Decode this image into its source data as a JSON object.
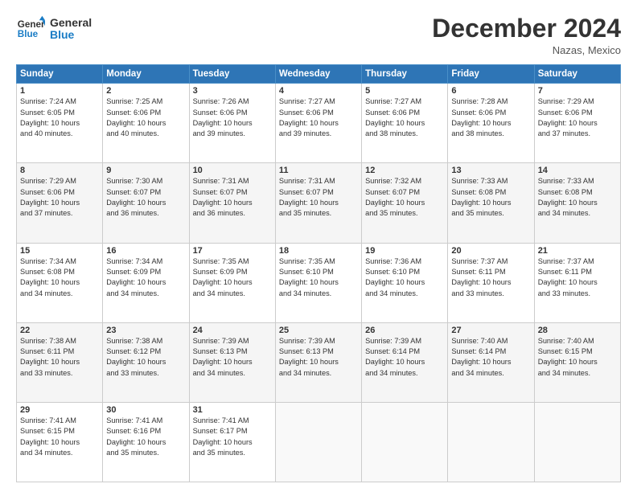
{
  "header": {
    "logo_line1": "General",
    "logo_line2": "Blue",
    "month_title": "December 2024",
    "location": "Nazas, Mexico"
  },
  "days_of_week": [
    "Sunday",
    "Monday",
    "Tuesday",
    "Wednesday",
    "Thursday",
    "Friday",
    "Saturday"
  ],
  "weeks": [
    [
      {
        "day": "1",
        "info": "Sunrise: 7:24 AM\nSunset: 6:05 PM\nDaylight: 10 hours\nand 40 minutes."
      },
      {
        "day": "2",
        "info": "Sunrise: 7:25 AM\nSunset: 6:06 PM\nDaylight: 10 hours\nand 40 minutes."
      },
      {
        "day": "3",
        "info": "Sunrise: 7:26 AM\nSunset: 6:06 PM\nDaylight: 10 hours\nand 39 minutes."
      },
      {
        "day": "4",
        "info": "Sunrise: 7:27 AM\nSunset: 6:06 PM\nDaylight: 10 hours\nand 39 minutes."
      },
      {
        "day": "5",
        "info": "Sunrise: 7:27 AM\nSunset: 6:06 PM\nDaylight: 10 hours\nand 38 minutes."
      },
      {
        "day": "6",
        "info": "Sunrise: 7:28 AM\nSunset: 6:06 PM\nDaylight: 10 hours\nand 38 minutes."
      },
      {
        "day": "7",
        "info": "Sunrise: 7:29 AM\nSunset: 6:06 PM\nDaylight: 10 hours\nand 37 minutes."
      }
    ],
    [
      {
        "day": "8",
        "info": "Sunrise: 7:29 AM\nSunset: 6:06 PM\nDaylight: 10 hours\nand 37 minutes."
      },
      {
        "day": "9",
        "info": "Sunrise: 7:30 AM\nSunset: 6:07 PM\nDaylight: 10 hours\nand 36 minutes."
      },
      {
        "day": "10",
        "info": "Sunrise: 7:31 AM\nSunset: 6:07 PM\nDaylight: 10 hours\nand 36 minutes."
      },
      {
        "day": "11",
        "info": "Sunrise: 7:31 AM\nSunset: 6:07 PM\nDaylight: 10 hours\nand 35 minutes."
      },
      {
        "day": "12",
        "info": "Sunrise: 7:32 AM\nSunset: 6:07 PM\nDaylight: 10 hours\nand 35 minutes."
      },
      {
        "day": "13",
        "info": "Sunrise: 7:33 AM\nSunset: 6:08 PM\nDaylight: 10 hours\nand 35 minutes."
      },
      {
        "day": "14",
        "info": "Sunrise: 7:33 AM\nSunset: 6:08 PM\nDaylight: 10 hours\nand 34 minutes."
      }
    ],
    [
      {
        "day": "15",
        "info": "Sunrise: 7:34 AM\nSunset: 6:08 PM\nDaylight: 10 hours\nand 34 minutes."
      },
      {
        "day": "16",
        "info": "Sunrise: 7:34 AM\nSunset: 6:09 PM\nDaylight: 10 hours\nand 34 minutes."
      },
      {
        "day": "17",
        "info": "Sunrise: 7:35 AM\nSunset: 6:09 PM\nDaylight: 10 hours\nand 34 minutes."
      },
      {
        "day": "18",
        "info": "Sunrise: 7:35 AM\nSunset: 6:10 PM\nDaylight: 10 hours\nand 34 minutes."
      },
      {
        "day": "19",
        "info": "Sunrise: 7:36 AM\nSunset: 6:10 PM\nDaylight: 10 hours\nand 34 minutes."
      },
      {
        "day": "20",
        "info": "Sunrise: 7:37 AM\nSunset: 6:11 PM\nDaylight: 10 hours\nand 33 minutes."
      },
      {
        "day": "21",
        "info": "Sunrise: 7:37 AM\nSunset: 6:11 PM\nDaylight: 10 hours\nand 33 minutes."
      }
    ],
    [
      {
        "day": "22",
        "info": "Sunrise: 7:38 AM\nSunset: 6:11 PM\nDaylight: 10 hours\nand 33 minutes."
      },
      {
        "day": "23",
        "info": "Sunrise: 7:38 AM\nSunset: 6:12 PM\nDaylight: 10 hours\nand 33 minutes."
      },
      {
        "day": "24",
        "info": "Sunrise: 7:39 AM\nSunset: 6:13 PM\nDaylight: 10 hours\nand 34 minutes."
      },
      {
        "day": "25",
        "info": "Sunrise: 7:39 AM\nSunset: 6:13 PM\nDaylight: 10 hours\nand 34 minutes."
      },
      {
        "day": "26",
        "info": "Sunrise: 7:39 AM\nSunset: 6:14 PM\nDaylight: 10 hours\nand 34 minutes."
      },
      {
        "day": "27",
        "info": "Sunrise: 7:40 AM\nSunset: 6:14 PM\nDaylight: 10 hours\nand 34 minutes."
      },
      {
        "day": "28",
        "info": "Sunrise: 7:40 AM\nSunset: 6:15 PM\nDaylight: 10 hours\nand 34 minutes."
      }
    ],
    [
      {
        "day": "29",
        "info": "Sunrise: 7:41 AM\nSunset: 6:15 PM\nDaylight: 10 hours\nand 34 minutes."
      },
      {
        "day": "30",
        "info": "Sunrise: 7:41 AM\nSunset: 6:16 PM\nDaylight: 10 hours\nand 35 minutes."
      },
      {
        "day": "31",
        "info": "Sunrise: 7:41 AM\nSunset: 6:17 PM\nDaylight: 10 hours\nand 35 minutes."
      },
      null,
      null,
      null,
      null
    ]
  ]
}
